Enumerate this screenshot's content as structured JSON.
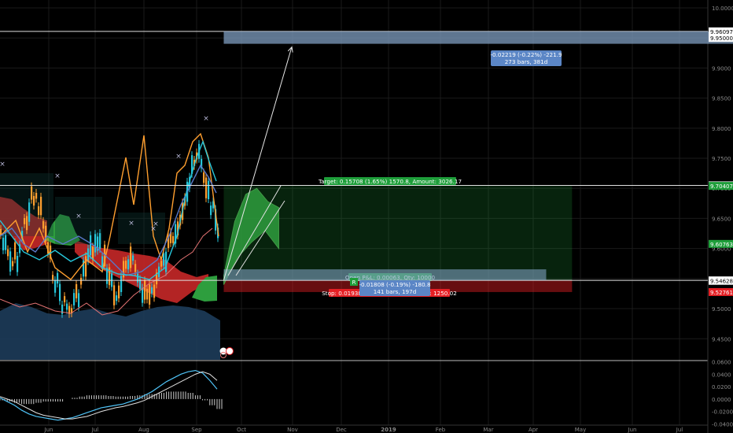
{
  "chart_data": {
    "type": "line",
    "title": "",
    "main_axis": {
      "ylim": [
        9.415,
        10.0
      ],
      "ticks": [
        "10.0000",
        "9.9500",
        "9.9000",
        "9.8500",
        "9.8000",
        "9.7500",
        "9.7000",
        "9.6500",
        "9.6000",
        "9.5500",
        "9.5000",
        "9.4500"
      ]
    },
    "osc_axis": {
      "ylim": [
        -0.042,
        0.062
      ],
      "ticks": [
        "0.0600",
        "0.0400",
        "0.0200",
        "0.0000",
        "-0.0200",
        "-0.0400"
      ]
    },
    "x_labels": [
      "Jun",
      "Jul",
      "Aug",
      "Sep",
      "Oct",
      "Nov",
      "Dec",
      "2019",
      "Feb",
      "Mar",
      "Apr",
      "May",
      "Jun",
      "Jul"
    ],
    "price_badges": [
      {
        "label": "9.96097",
        "value": 9.96097,
        "bg": "#ffffff",
        "fg": "#000000"
      },
      {
        "label": "9.95000",
        "value": 9.95,
        "bg": "#ffffff",
        "fg": "#000000"
      },
      {
        "label": "9.70495",
        "value": 9.70495,
        "bg": "#ffffff",
        "fg": "#000000"
      },
      {
        "label": "9.70407",
        "value": 9.70407,
        "bg": "#1e9e3a",
        "fg": "#ffffff"
      },
      {
        "label": "9.60763",
        "value": 9.60763,
        "bg": "#1e9e3a",
        "fg": "#ffffff"
      },
      {
        "label": "9.54699",
        "value": 9.54699,
        "bg": "#ffffff",
        "fg": "#000000"
      },
      {
        "label": "9.54628",
        "value": 9.54628,
        "bg": "#ffffff",
        "fg": "#000000"
      },
      {
        "label": "9.52761",
        "value": 9.52761,
        "bg": "#e51f24",
        "fg": "#ffffff"
      }
    ],
    "horizontal_lines": [
      9.96097,
      9.70495,
      9.54699
    ],
    "position": {
      "target_label": "Target: 0.15708 (1.65%) 1570.8, Amount: 3026.17",
      "open_label": "Open P&L: 0.00063, Qty: 10000",
      "ratio_label": "R",
      "stop_label": "Stop: 0.01938 (0.20%) 193.8, Amount: 1250.02",
      "entry": 9.5473,
      "target": 9.70407,
      "stop": 9.52761,
      "start": "2018-09-17",
      "end": "2019-04-20"
    },
    "measure_top": {
      "label1": "-0.02219 (-0.22%) -221.9",
      "label2": "273 bars, 381d",
      "from": 9.9403,
      "to": 9.96097,
      "start": "2018-09-17",
      "end": "2019-10-02"
    },
    "measure_mid": {
      "label1": "-0.01808 (-0.19%) -180.8",
      "label2": "141 bars, 197d",
      "from": 9.5473,
      "to": 9.56538
    },
    "arrow": {
      "from_date": "2018-09-17",
      "from_value": 9.5473,
      "to_date": "2018-10-29",
      "to_value": 9.935
    },
    "projection": {
      "upper": [
        [
          9.555,
          9.555
        ],
        [
          9.585,
          9.645
        ],
        [
          9.605,
          9.69
        ],
        [
          9.633,
          9.7
        ],
        [
          9.645,
          9.678
        ],
        [
          9.654,
          9.668
        ]
      ],
      "lower": [
        [
          9.54,
          9.54
        ],
        [
          9.56,
          9.585
        ],
        [
          9.58,
          9.61
        ],
        [
          9.6,
          9.63
        ],
        [
          9.61,
          9.6
        ]
      ]
    },
    "oscillator": {
      "line1": [
        0.002,
        -0.004,
        -0.01,
        -0.018,
        -0.024,
        -0.028,
        -0.03,
        -0.032,
        -0.034,
        -0.032,
        -0.03,
        -0.026,
        -0.022,
        -0.018,
        -0.014,
        -0.012,
        -0.01,
        -0.008,
        -0.004,
        0,
        0.006,
        0.012,
        0.02,
        0.028,
        0.034,
        0.04,
        0.044,
        0.046,
        0.042,
        0.03,
        0.016
      ],
      "line2": [
        0.004,
        0,
        -0.004,
        -0.01,
        -0.016,
        -0.022,
        -0.026,
        -0.028,
        -0.03,
        -0.032,
        -0.032,
        -0.03,
        -0.028,
        -0.024,
        -0.02,
        -0.017,
        -0.014,
        -0.012,
        -0.009,
        -0.006,
        -0.002,
        0.004,
        0.01,
        0.016,
        0.022,
        0.028,
        0.034,
        0.04,
        0.044,
        0.04,
        0.03
      ],
      "hist": [
        -0.002,
        -0.004,
        -0.006,
        -0.008,
        -0.008,
        -0.006,
        -0.004,
        -0.004,
        -0.004,
        0,
        0.002,
        0.004,
        0.006,
        0.006,
        0.006,
        0.005,
        0.004,
        0.004,
        0.005,
        0.006,
        0.008,
        0.008,
        0.01,
        0.012,
        0.012,
        0.012,
        0.01,
        0.006,
        -0.002,
        -0.01,
        -0.016
      ]
    },
    "colors": {
      "target_zone": "#1e9e3a",
      "stop_zone": "#e51f24",
      "cloud_red": "#c62828",
      "cloud_green": "#2e9e3e",
      "cloud_blue": "#1f3f5f",
      "orange": "#ff9f2f",
      "cyan": "#26c6da",
      "blue": "#5a78c8",
      "pink": "#e57373",
      "measure": "#7f9ec0",
      "grid": "#1a1a1a"
    }
  }
}
